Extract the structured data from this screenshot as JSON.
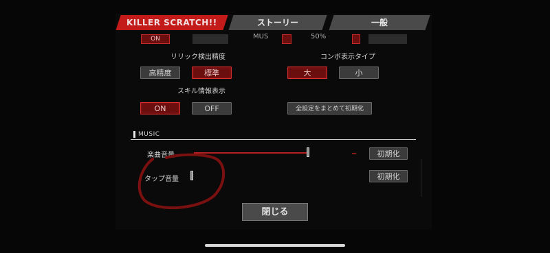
{
  "tabs": [
    {
      "label": "KILLER SCRATCH!!"
    },
    {
      "label": "ストーリー"
    },
    {
      "label": "一般"
    }
  ],
  "top_row": {
    "btn1_label": "ON",
    "text1": "MUS",
    "text2": "50%"
  },
  "rhythm_section": {
    "label": "リリック検出精度",
    "options": [
      "高精度",
      "標準"
    ],
    "selected": "標準"
  },
  "combo_section": {
    "label": "コンボ表示タイプ",
    "options": [
      "大",
      "小"
    ],
    "selected": "大"
  },
  "skill_section": {
    "label": "スキル情報表示",
    "options": [
      "ON",
      "OFF"
    ],
    "selected": "ON"
  },
  "reset_all_label": "全設定をまとめて初期化",
  "music_section": {
    "title": "MUSIC",
    "song_volume_label": "楽曲音量",
    "song_volume_level": 1.0,
    "tap_volume_label": "タップ音量",
    "tap_volume_level": 0.0,
    "reset_label": "初期化"
  },
  "close_label": "閉じる",
  "colors": {
    "accent_red": "#c31a1a",
    "annotation": "#7a1010"
  }
}
